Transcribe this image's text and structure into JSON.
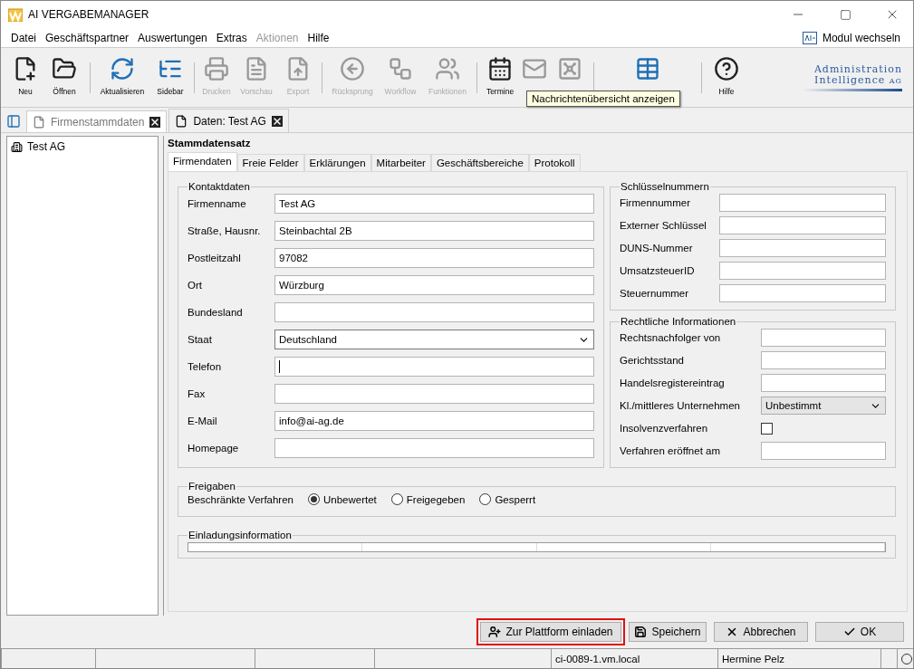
{
  "window": {
    "title": "AI VERGABEMANAGER",
    "module_switch": "Modul wechseln"
  },
  "menu": [
    {
      "label": "Datei",
      "disabled": false
    },
    {
      "label": "Geschäftspartner",
      "disabled": false
    },
    {
      "label": "Auswertungen",
      "disabled": false
    },
    {
      "label": "Extras",
      "disabled": false
    },
    {
      "label": "Aktionen",
      "disabled": true
    },
    {
      "label": "Hilfe",
      "disabled": false
    }
  ],
  "toolbar": [
    {
      "kind": "button",
      "label": "Neu",
      "disabled": false
    },
    {
      "kind": "button",
      "label": "Öffnen",
      "disabled": false
    },
    {
      "kind": "separator"
    },
    {
      "kind": "button",
      "label": "Aktualisieren",
      "disabled": false
    },
    {
      "kind": "button",
      "label": "Sidebar",
      "disabled": false
    },
    {
      "kind": "separator"
    },
    {
      "kind": "button",
      "label": "Drucken",
      "disabled": true
    },
    {
      "kind": "button",
      "label": "Vorschau",
      "disabled": true
    },
    {
      "kind": "button",
      "label": "Export",
      "disabled": true
    },
    {
      "kind": "separator"
    },
    {
      "kind": "button",
      "label": "Rücksprung",
      "disabled": true
    },
    {
      "kind": "button",
      "label": "Workflow",
      "disabled": true
    },
    {
      "kind": "button",
      "label": "Funktionen",
      "disabled": true
    },
    {
      "kind": "separator"
    },
    {
      "kind": "button",
      "label": "Termine",
      "disabled": false
    },
    {
      "kind": "button",
      "disabled": true
    },
    {
      "kind": "button",
      "disabled": true
    },
    {
      "kind": "separator"
    },
    {
      "kind": "button",
      "disabled": false
    },
    {
      "kind": "separator"
    },
    {
      "kind": "button",
      "label": "Hilfe",
      "disabled": false
    }
  ],
  "tooltip": "Nachrichtenübersicht anzeigen",
  "logo": {
    "line1": "Administration",
    "line2": "Intelligence",
    "suffix": "AG"
  },
  "doc_tabs": [
    {
      "label": "Firmenstammdaten",
      "selected": false
    },
    {
      "label": "Daten: Test AG",
      "selected": true
    }
  ],
  "tree": [
    {
      "label": "Test AG"
    }
  ],
  "section_title": "Stammdatensatz",
  "tabs": [
    {
      "label": "Firmendaten",
      "selected": true
    },
    {
      "label": "Freie Felder",
      "selected": false
    },
    {
      "label": "Erklärungen",
      "selected": false
    },
    {
      "label": "Mitarbeiter",
      "selected": false
    },
    {
      "label": "Geschäftsbereiche",
      "selected": false
    },
    {
      "label": "Protokoll",
      "selected": false
    }
  ],
  "kontaktdaten": {
    "title": "Kontaktdaten",
    "fields": [
      {
        "kind": "text",
        "label": "Firmenname",
        "value": "Test AG"
      },
      {
        "kind": "text",
        "label": "Straße, Hausnr.",
        "value": "Steinbachtal 2B"
      },
      {
        "kind": "text",
        "label": "Postleitzahl",
        "value": "97082"
      },
      {
        "kind": "text",
        "label": "Ort",
        "value": "Würzburg"
      },
      {
        "kind": "text",
        "label": "Bundesland"
      },
      {
        "kind": "select",
        "label": "Staat",
        "value": "Deutschland"
      },
      {
        "kind": "text",
        "label": "Telefon",
        "focused": true
      },
      {
        "kind": "text",
        "label": "Fax"
      },
      {
        "kind": "text",
        "label": "E-Mail",
        "value": "info@ai-ag.de"
      },
      {
        "kind": "text",
        "label": "Homepage"
      }
    ]
  },
  "schluesselnummern": {
    "title": "Schlüsselnummern",
    "fields": [
      {
        "kind": "text",
        "label": "Firmennummer"
      },
      {
        "kind": "text",
        "label": "Externer Schlüssel"
      },
      {
        "kind": "text",
        "label": "DUNS-Nummer"
      },
      {
        "kind": "text",
        "label": "UmsatzsteuerID"
      },
      {
        "kind": "text",
        "label": "Steuernummer"
      }
    ]
  },
  "rechtliche": {
    "title": "Rechtliche Informationen",
    "fields": [
      {
        "kind": "text",
        "label": "Rechtsnachfolger von"
      },
      {
        "kind": "text",
        "label": "Gerichtsstand"
      },
      {
        "kind": "text",
        "label": "Handelsregistereintrag"
      },
      {
        "kind": "combo",
        "label": "Kl./mittleres Unternehmen",
        "value": "Unbestimmt"
      },
      {
        "kind": "checkbox",
        "label": "Insolvenzverfahren",
        "checked": false
      },
      {
        "kind": "text",
        "label": "Verfahren eröffnet am"
      }
    ]
  },
  "freigaben": {
    "title": "Freigaben",
    "label": "Beschränkte Verfahren",
    "options": [
      {
        "label": "Unbewertet",
        "selected": true
      },
      {
        "label": "Freigegeben",
        "selected": false
      },
      {
        "label": "Gesperrt",
        "selected": false
      }
    ]
  },
  "einladung": {
    "title": "Einladungsinformation"
  },
  "buttons": [
    {
      "label": "Zur Plattform einladen",
      "highlighted": true
    },
    {
      "label": "Speichern",
      "highlighted": false
    },
    {
      "label": "Abbrechen",
      "highlighted": false
    },
    {
      "label": "OK",
      "highlighted": false
    }
  ],
  "status_bar": [
    "ci-0089-1.vm.local",
    "Hermine Pelz"
  ]
}
